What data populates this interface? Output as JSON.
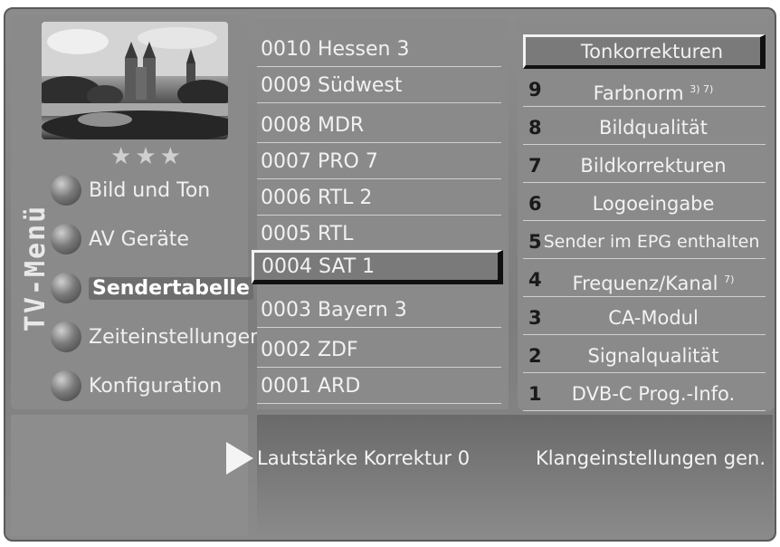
{
  "menu": {
    "title": "TV-Menü",
    "stars": "★★★",
    "items": [
      {
        "label": "Bild und Ton"
      },
      {
        "label": "AV Geräte"
      },
      {
        "label": "Sendertabelle"
      },
      {
        "label": "Zeiteinstellungen"
      },
      {
        "label": "Konfiguration"
      }
    ]
  },
  "channels": [
    {
      "label": "0010 Hessen 3"
    },
    {
      "label": "0009 Südwest"
    },
    {
      "label": "0008 MDR"
    },
    {
      "label": "0007 PRO 7"
    },
    {
      "label": "0006 RTL 2"
    },
    {
      "label": "0005 RTL"
    },
    {
      "label": "0004 SAT 1"
    },
    {
      "label": "0003 Bayern 3"
    },
    {
      "label": "0002 ZDF"
    },
    {
      "label": "0001 ARD"
    }
  ],
  "submenu": [
    {
      "num": "",
      "label": "Tonkorrekturen",
      "sup": ""
    },
    {
      "num": "9",
      "label": "Farbnorm",
      "sup": "3) 7)"
    },
    {
      "num": "8",
      "label": "Bildqualität",
      "sup": ""
    },
    {
      "num": "7",
      "label": "Bildkorrekturen",
      "sup": ""
    },
    {
      "num": "6",
      "label": "Logoeingabe",
      "sup": ""
    },
    {
      "num": "5",
      "label": "Sender im EPG enthalten",
      "sup": ""
    },
    {
      "num": "4",
      "label": "Frequenz/Kanal",
      "sup": "7)"
    },
    {
      "num": "3",
      "label": "CA-Modul",
      "sup": ""
    },
    {
      "num": "2",
      "label": "Signalqualität",
      "sup": ""
    },
    {
      "num": "1",
      "label": "DVB-C Prog.-Info.",
      "sup": ""
    }
  ],
  "bottom": {
    "setting": "Lautstärke Korrektur 0",
    "hint": "Klangeinstellungen gen."
  },
  "colors": {
    "panel": "#8a8a8a",
    "text": "#f2f2f2",
    "selection_frame": "#f2f2f2"
  }
}
